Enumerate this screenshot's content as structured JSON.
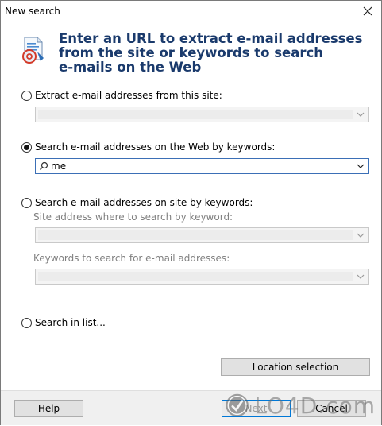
{
  "window": {
    "title": "New search"
  },
  "header": {
    "line1": "Enter an URL to extract e-mail addresses",
    "line2": "from the site or keywords to search",
    "line3": "e-mails on the Web"
  },
  "options": {
    "extract_site": {
      "label": "Extract e-mail addresses from this site:",
      "checked": false
    },
    "web_keywords": {
      "label": "Search e-mail addresses on the Web by keywords:",
      "checked": true,
      "value": "me"
    },
    "site_keywords": {
      "label": "Search e-mail addresses on site by keywords:",
      "checked": false,
      "site_label": "Site address where to search by keyword:",
      "keywords_label": "Keywords to search for e-mail addresses:"
    },
    "search_list": {
      "label": "Search in list...",
      "checked": false
    }
  },
  "buttons": {
    "location": "Location selection",
    "help": "Help",
    "next": "Next",
    "cancel": "Cancel"
  },
  "watermark": {
    "text": "LO4D.com"
  },
  "colors": {
    "header_text": "#1a3a6c",
    "focus_border": "#3b6fb6",
    "default_button": "#0078d7"
  }
}
